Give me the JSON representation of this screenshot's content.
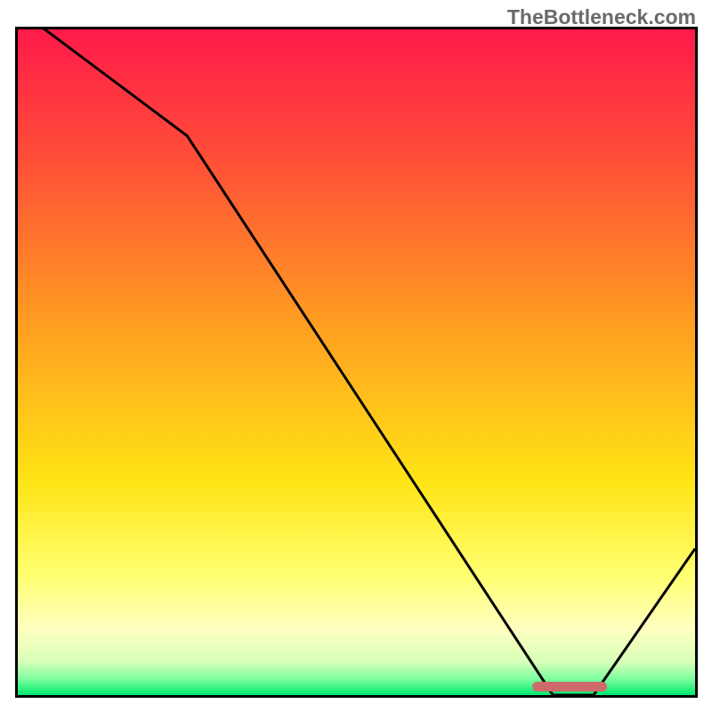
{
  "watermark": "TheBottleneck.com",
  "chart_data": {
    "type": "line",
    "title": "",
    "xlabel": "",
    "ylabel": "",
    "xlim": [
      0,
      100
    ],
    "ylim": [
      0,
      100
    ],
    "x": [
      0,
      4,
      25,
      79,
      85,
      100
    ],
    "values": [
      102,
      100,
      84,
      0,
      0,
      22
    ],
    "gradient_stops": [
      {
        "pos": 0.0,
        "color": "#ff1a4a"
      },
      {
        "pos": 0.2,
        "color": "#ff5037"
      },
      {
        "pos": 0.45,
        "color": "#ffa020"
      },
      {
        "pos": 0.68,
        "color": "#ffe515"
      },
      {
        "pos": 0.82,
        "color": "#ffff70"
      },
      {
        "pos": 0.9,
        "color": "#ffffc0"
      },
      {
        "pos": 0.95,
        "color": "#d8ffb8"
      },
      {
        "pos": 0.975,
        "color": "#80ffa0"
      },
      {
        "pos": 1.0,
        "color": "#00e870"
      }
    ],
    "optimal_range": {
      "start": 76,
      "end": 87,
      "y": 1.5
    }
  }
}
